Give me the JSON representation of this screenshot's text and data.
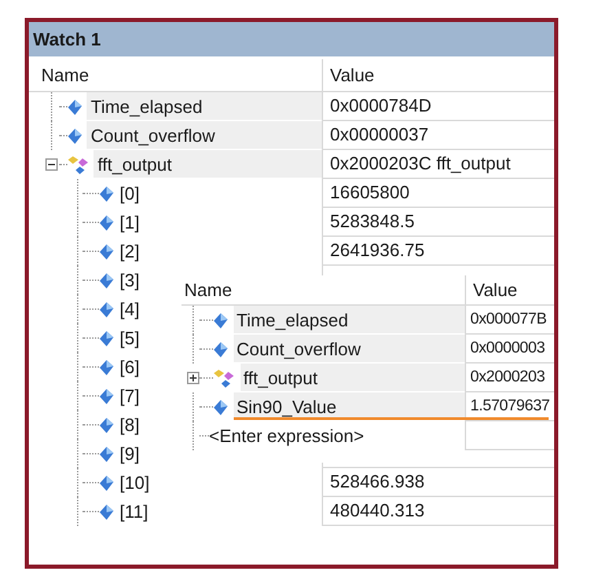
{
  "window": {
    "title": "Watch 1"
  },
  "columns": [
    "Name",
    "Value"
  ],
  "rows": [
    {
      "kind": "variable",
      "name": "Time_elapsed",
      "value": "0x0000784D"
    },
    {
      "kind": "variable",
      "name": "Count_overflow",
      "value": "0x00000037"
    },
    {
      "kind": "struct",
      "name": "fft_output",
      "value": "0x2000203C fft_output",
      "expanded": true,
      "children": [
        {
          "kind": "variable",
          "name": "[0]",
          "value": "16605800"
        },
        {
          "kind": "variable",
          "name": "[1]",
          "value": "5283848.5"
        },
        {
          "kind": "variable",
          "name": "[2]",
          "value": "2641936.75"
        },
        {
          "kind": "variable",
          "name": "[3]"
        },
        {
          "kind": "variable",
          "name": "[4]"
        },
        {
          "kind": "variable",
          "name": "[5]"
        },
        {
          "kind": "variable",
          "name": "[6]"
        },
        {
          "kind": "variable",
          "name": "[7]"
        },
        {
          "kind": "variable",
          "name": "[8]"
        },
        {
          "kind": "variable",
          "name": "[9]"
        },
        {
          "kind": "variable",
          "name": "[10]",
          "value": "528466.938"
        },
        {
          "kind": "variable",
          "name": "[11]",
          "value": "480440.313"
        }
      ]
    }
  ],
  "overlay": {
    "columns": [
      "Name",
      "Value"
    ],
    "rows": [
      {
        "kind": "variable",
        "name": "Time_elapsed",
        "value": "0x000077B",
        "highlighted": false
      },
      {
        "kind": "variable",
        "name": "Count_overflow",
        "value": "0x0000003",
        "highlighted": false
      },
      {
        "kind": "struct",
        "name": "fft_output",
        "value": "0x2000203",
        "expanded": false,
        "highlighted": false
      },
      {
        "kind": "variable",
        "name": "Sin90_Value",
        "value": "1.57079637",
        "highlighted": true
      }
    ],
    "entry_placeholder": "<Enter expression>"
  }
}
